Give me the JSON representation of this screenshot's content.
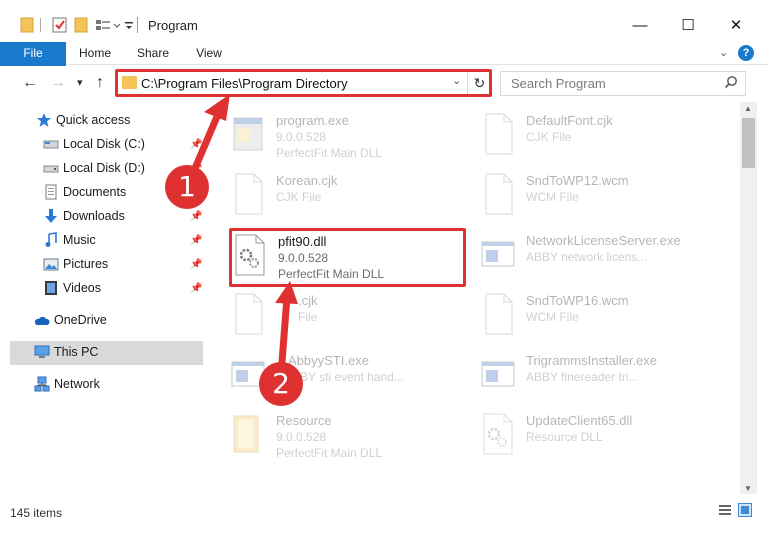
{
  "window": {
    "title": "Program",
    "minimize_glyph": "—",
    "maximize_glyph": "☐",
    "close_glyph": "✕"
  },
  "ribbon": {
    "tabs": [
      {
        "label": "File"
      },
      {
        "label": "Home"
      },
      {
        "label": "Share"
      },
      {
        "label": "View"
      }
    ],
    "expand_glyph": "⌄",
    "help_glyph": "?"
  },
  "nav": {
    "back_glyph": "←",
    "forward_glyph": "→",
    "recent_glyph": "▾",
    "up_glyph": "↑",
    "address": "C:\\Program Files\\Program Directory",
    "dropdown_glyph": "⌄",
    "refresh_glyph": "↻",
    "search_placeholder": "Search Program"
  },
  "sidebar": {
    "items": [
      {
        "label": "Quick access",
        "icon": "star-icon"
      },
      {
        "label": "Local Disk (C:)",
        "icon": "drive-icon"
      },
      {
        "label": "Local Disk (D:)",
        "icon": "drive-icon"
      },
      {
        "label": "Documents",
        "icon": "documents-icon"
      },
      {
        "label": "Downloads",
        "icon": "download-icon"
      },
      {
        "label": "Music",
        "icon": "music-icon"
      },
      {
        "label": "Pictures",
        "icon": "pictures-icon"
      },
      {
        "label": "Videos",
        "icon": "videos-icon"
      },
      {
        "label": "OneDrive",
        "icon": "cloud-icon"
      },
      {
        "label": "This PC",
        "icon": "computer-icon"
      },
      {
        "label": "Network",
        "icon": "network-icon"
      }
    ],
    "pin_glyph": "📌"
  },
  "files": [
    {
      "name": "program.exe",
      "meta1": "9.0.0.528",
      "meta2": "PerfectFit Main DLL",
      "icon": "exe-icon"
    },
    {
      "name": "DefaultFont.cjk",
      "meta1": "CJK File",
      "meta2": "",
      "icon": "blank-file-icon"
    },
    {
      "name": "Korean.cjk",
      "meta1": "CJK File",
      "meta2": "",
      "icon": "blank-file-icon"
    },
    {
      "name": "SndToWP12.wcm",
      "meta1": "WCM File",
      "meta2": "",
      "icon": "blank-file-icon"
    },
    {
      "name": "pfit90.dll",
      "meta1": "9.0.0.528",
      "meta2": "PerfectFit Main DLL",
      "icon": "dll-icon"
    },
    {
      "name": "NetworkLicenseServer.exe",
      "meta1": "ABBY network licens...",
      "meta2": "",
      "icon": "app-window-icon"
    },
    {
      "name": ".cjk",
      "meta1": "File",
      "meta2": "",
      "icon": "blank-file-icon"
    },
    {
      "name": "SndToWP16.wcm",
      "meta1": "WCM File",
      "meta2": "",
      "icon": "blank-file-icon"
    },
    {
      "name": "AbbyySTI.exe",
      "meta1": "BBY sti event hand...",
      "meta2": "",
      "icon": "app-window-icon"
    },
    {
      "name": "TrigrammsInstaller.exe",
      "meta1": "ABBY finereader tri...",
      "meta2": "",
      "icon": "app-window-icon"
    },
    {
      "name": "Resource",
      "meta1": "9.0.0.528",
      "meta2": "PerfectFit Main DLL",
      "icon": "folder-icon"
    },
    {
      "name": "UpdateClient65.dll",
      "meta1": "Resource DLL",
      "meta2": "",
      "icon": "dll-icon"
    }
  ],
  "status": {
    "item_count": "145 items"
  },
  "annotations": {
    "step1": "1",
    "step2": "2",
    "color": "#e03131"
  }
}
